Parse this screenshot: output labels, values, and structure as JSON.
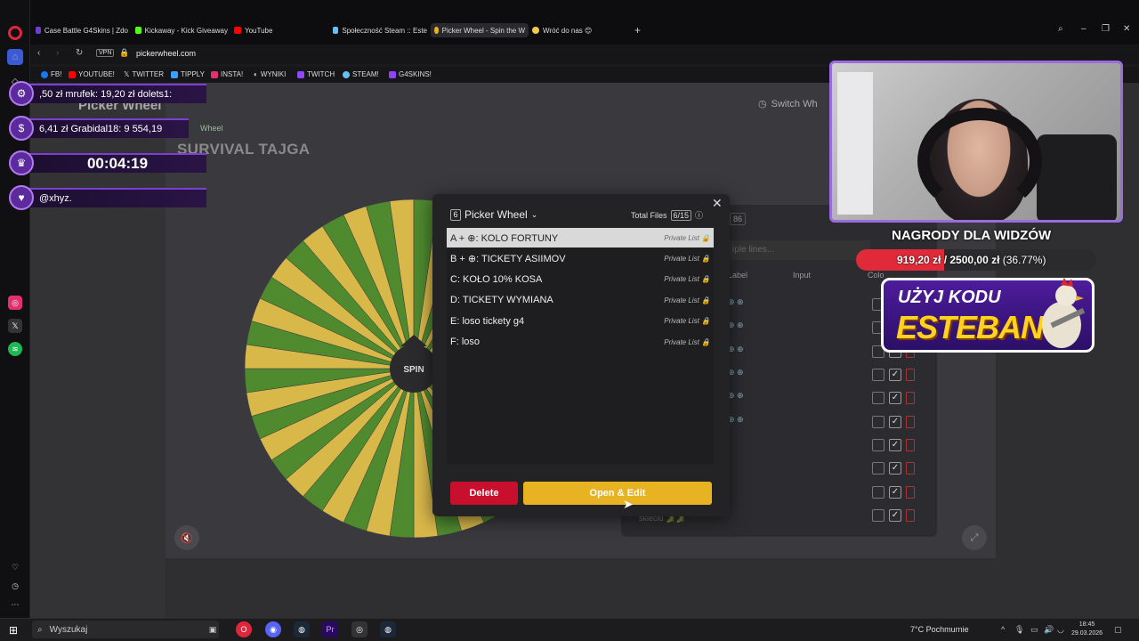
{
  "browser": {
    "tabs": [
      {
        "label": "Case Battle G4Skins | Zdo",
        "color": "#6d3fd1"
      },
      {
        "label": "Kickaway - Kick Giveaway",
        "color": "#53fc18"
      },
      {
        "label": "YouTube",
        "color": "#ff0000"
      },
      {
        "label": "Społeczność Steam :: Este",
        "color": "#1b2838"
      },
      {
        "label": "Picker Wheel - Spin the W",
        "color": "#e8b322",
        "active": true
      },
      {
        "label": "Wróć do nas 😊",
        "color": "#f2c94c"
      }
    ],
    "vpn_label": "VPN",
    "url": "pickerwheel.com",
    "bookmarks": [
      {
        "label": "FB!",
        "color": "#1877f2"
      },
      {
        "label": "YOUTUBE!",
        "color": "#ff0000"
      },
      {
        "label": "TWITTER",
        "color": "#ffffff"
      },
      {
        "label": "TIPPLY",
        "color": "#3aa0ff"
      },
      {
        "label": "INSTA!",
        "color": "#e1306c"
      },
      {
        "label": "WYNIKI",
        "color": "#cccccc"
      },
      {
        "label": "TWITCH",
        "color": "#9146ff"
      },
      {
        "label": "STEAM!",
        "color": "#66c0f4"
      },
      {
        "label": "G4SKINS!",
        "color": "#8e44ff"
      }
    ]
  },
  "page": {
    "logo": "Picker Wheel",
    "wheel_tag": "Wheel",
    "title": "SURVIVAL TAJGA",
    "switch_label": "Switch Wh",
    "spin_label": "SPIN",
    "editor": {
      "count": "86",
      "paste_placeholder": "iple lines...",
      "col_label": "Label",
      "col_input": "Input",
      "col_color": "Colo",
      "last_entry": "skieciu 🐊🐊"
    }
  },
  "modal": {
    "selector_num": "6",
    "selector_label": "Picker Wheel",
    "total_files_label": "Total Files",
    "total_files_count": "6/15",
    "items": [
      {
        "label": "A + ⊕: KOLO FORTUNY",
        "tag": "Private List 🔒",
        "selected": true
      },
      {
        "label": "B + ⊕: TICKETY ASIIMOV",
        "tag": "Private List 🔒"
      },
      {
        "label": "C: KOŁO 10% KOSA",
        "tag": "Private List 🔒"
      },
      {
        "label": "D: TICKETY WYMIANA",
        "tag": "Private List 🔒"
      },
      {
        "label": "E: loso tickety g4",
        "tag": "Private List 🔒"
      },
      {
        "label": "F: loso",
        "tag": "Private List 🔒"
      }
    ],
    "delete_label": "Delete",
    "open_label": "Open & Edit",
    "close_glyph": "✕"
  },
  "overlay": {
    "donations_1": ",50 zł mrufek: 19,20 zł dolets1:",
    "donations_2": "6,41 zł Grabidal18: 9 554,19",
    "timer": "00:04:19",
    "follower": "@xhyz.",
    "rewards_title": "NAGRODY DLA WIDZÓW",
    "rewards_progress": "919,20 zł / 2500,00 zł",
    "rewards_pct": "(36.77%)",
    "rewards_fraction": 0.3677,
    "code_line1": "UŻYJ KODU",
    "code_line2": "ESTEBAN"
  },
  "taskbar": {
    "search_placeholder": "Wyszukaj",
    "weather": "7°C  Pochmurnie",
    "time": "18:45",
    "date": "29.03.2026"
  },
  "colors": {
    "wheel_green": "#4f8a2f",
    "wheel_yellow": "#d9b84a",
    "accent_yellow": "#e8b322",
    "delete_red": "#c8102e",
    "overlay_purple": "#7d3fd1"
  }
}
